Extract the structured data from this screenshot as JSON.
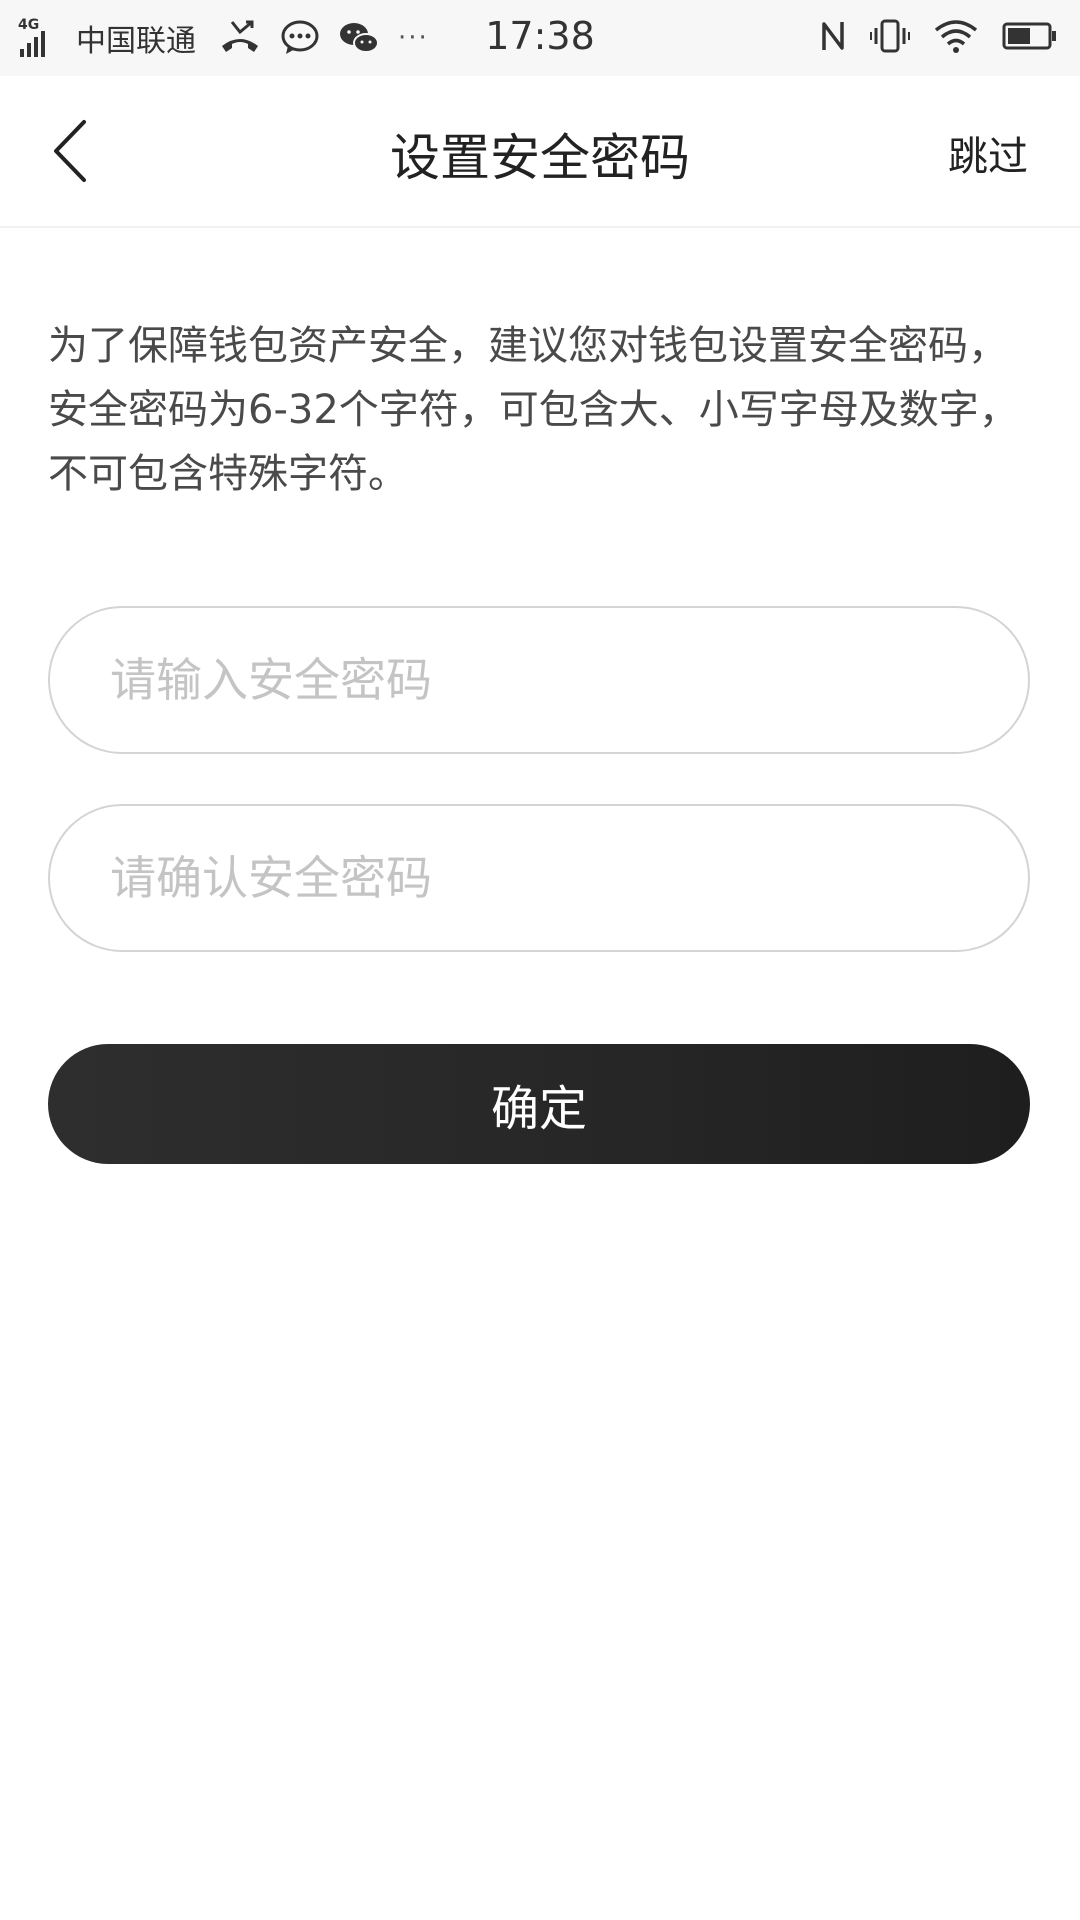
{
  "status_bar": {
    "network_type": "4G",
    "carrier": "中国联通",
    "more_indicator": "···",
    "time": "17:38",
    "icons": [
      "missed-call-icon",
      "message-icon",
      "wechat-icon",
      "nfc-icon",
      "vibrate-icon",
      "wifi-icon",
      "battery-icon"
    ]
  },
  "nav": {
    "back_icon": "chevron-left-icon",
    "title": "设置安全密码",
    "skip_label": "跳过"
  },
  "description": "为了保障钱包资产安全，建议您对钱包设置安全密码，安全密码为6-32个字符，可包含大、小写字母及数字，不可包含特殊字符。",
  "form": {
    "password_placeholder": "请输入安全密码",
    "password_value": "",
    "confirm_placeholder": "请确认安全密码",
    "confirm_value": "",
    "submit_label": "确定"
  },
  "colors": {
    "button_background": "#262626",
    "button_text": "#ffffff",
    "placeholder": "#c4c4c4",
    "border": "#d4d4d4"
  }
}
